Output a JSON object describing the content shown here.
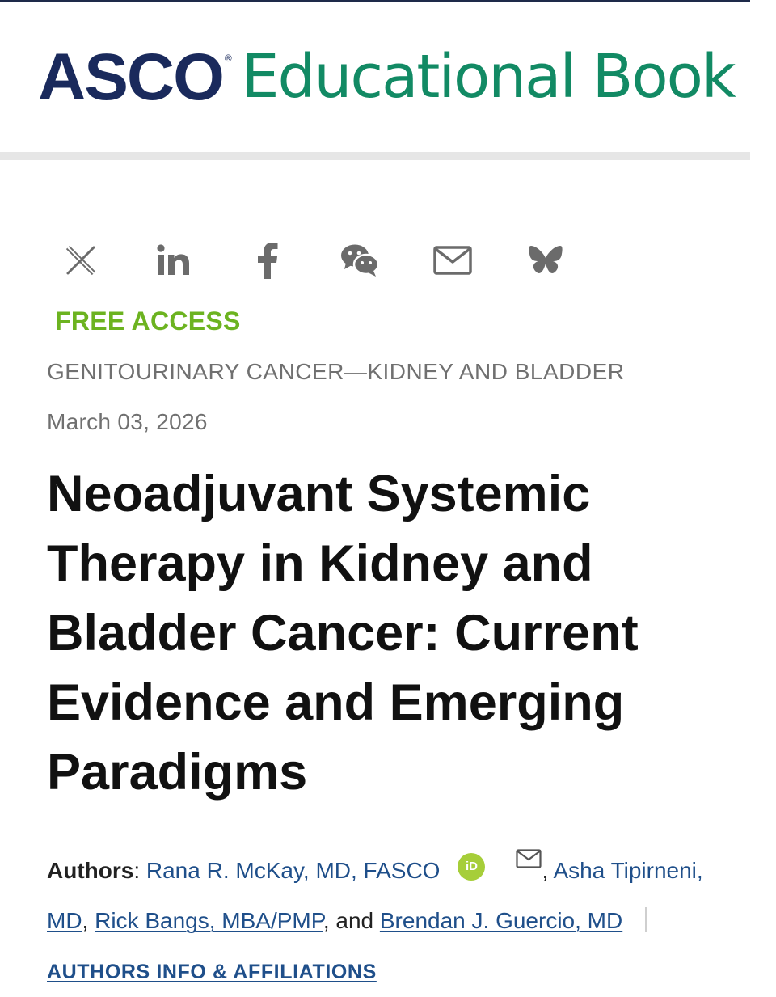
{
  "header": {
    "brand_primary": "ASCO",
    "brand_registered": "®",
    "brand_secondary": "Educational Book",
    "colors": {
      "navy": "#1a2a5c",
      "green": "#128a64"
    }
  },
  "share": {
    "icons": [
      "x-icon",
      "linkedin-icon",
      "facebook-icon",
      "wechat-icon",
      "email-icon",
      "bluesky-icon"
    ]
  },
  "article": {
    "access": "FREE ACCESS",
    "category": "GENITOURINARY CANCER—KIDNEY AND BLADDER",
    "date": "March 03, 2026",
    "title": "Neoadjuvant Systemic Therapy in Kidney and Bladder Cancer: Current Evidence and Emerging Paradigms"
  },
  "authors": {
    "label": "Authors",
    "label_sep": ": ",
    "list": [
      {
        "name": "Rana R. McKay, MD, FASCO"
      },
      {
        "name": "Asha Tipirneni, MD"
      },
      {
        "name": "Rick Bangs, MBA/PMP"
      },
      {
        "name": "Brendan J. Guercio, MD"
      }
    ],
    "orcid": "iD",
    "sep_comma": ", ",
    "sep_and": ", and ",
    "affiliations_link": "AUTHORS INFO & AFFILIATIONS"
  }
}
